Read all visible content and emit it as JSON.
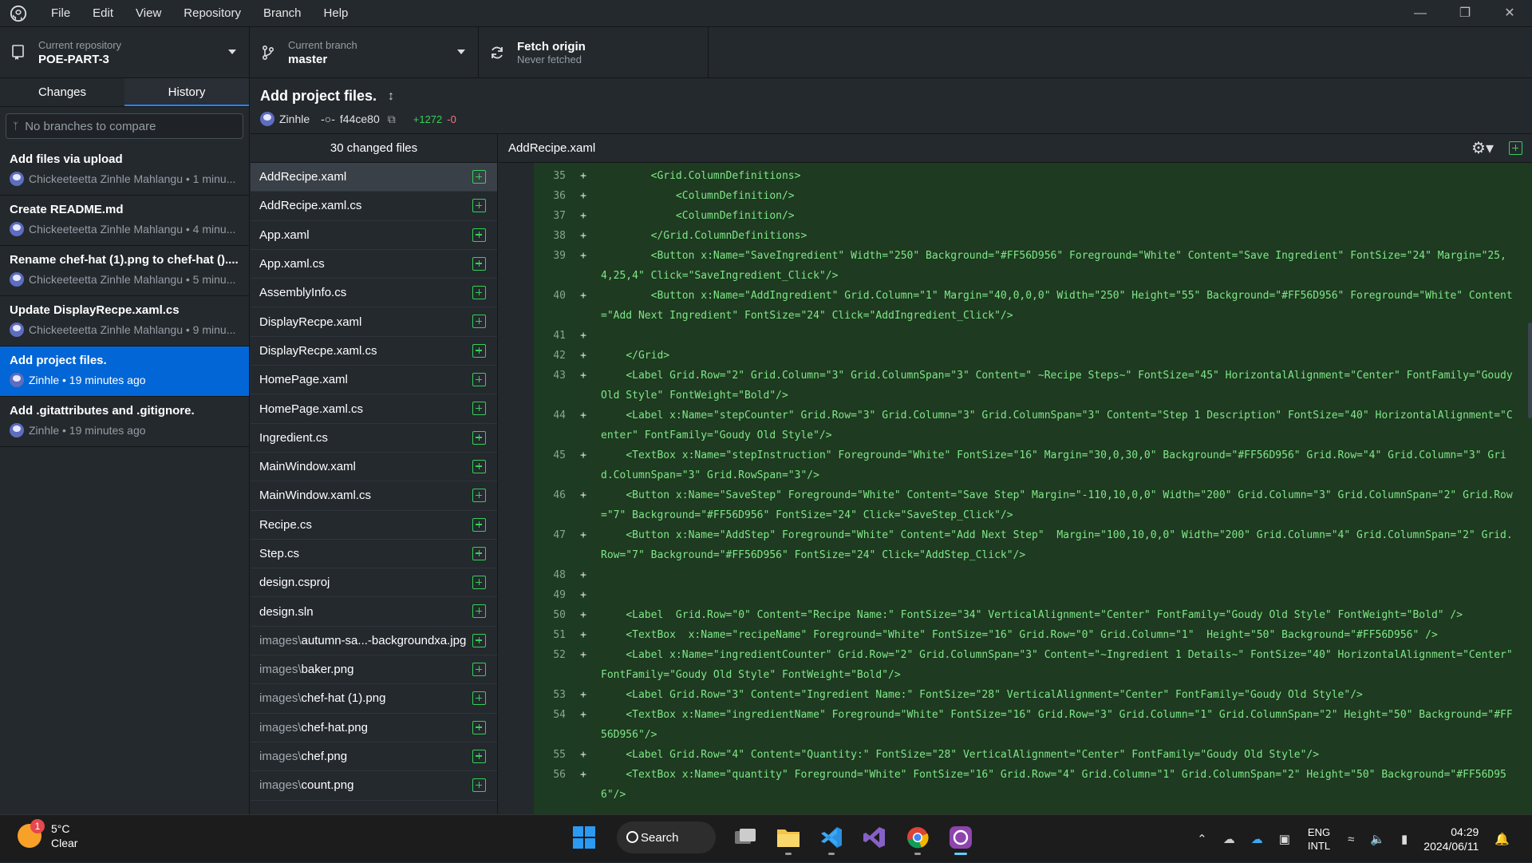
{
  "menu": [
    "File",
    "Edit",
    "View",
    "Repository",
    "Branch",
    "Help"
  ],
  "toolbar": {
    "repo_label": "Current repository",
    "repo_value": "POE-PART-3",
    "branch_label": "Current branch",
    "branch_value": "master",
    "fetch_label": "Fetch origin",
    "fetch_sub": "Never fetched"
  },
  "sidebar": {
    "tab_changes": "Changes",
    "tab_history": "History",
    "compare_placeholder": "No branches to compare",
    "commits": [
      {
        "title": "Add files via upload",
        "meta": "Chickeeteetta Zinhle Mahlangu • 1 minu..."
      },
      {
        "title": "Create README.md",
        "meta": "Chickeeteetta Zinhle Mahlangu • 4 minu..."
      },
      {
        "title": "Rename chef-hat (1).png to chef-hat ()....",
        "meta": "Chickeeteetta Zinhle Mahlangu • 5 minu..."
      },
      {
        "title": "Update DisplayRecpe.xaml.cs",
        "meta": "Chickeeteetta Zinhle Mahlangu • 9 minu..."
      },
      {
        "title": "Add project files.",
        "meta": "Zinhle • 19 minutes ago"
      },
      {
        "title": "Add .gitattributes and .gitignore.",
        "meta": "Zinhle • 19 minutes ago"
      }
    ]
  },
  "commit": {
    "title": "Add project files.",
    "author": "Zinhle",
    "sha": "f44ce80",
    "additions": "+1272",
    "deletions": "-0"
  },
  "files": {
    "header": "30 changed files",
    "items": [
      {
        "dir": "",
        "name": "AddRecipe.xaml"
      },
      {
        "dir": "",
        "name": "AddRecipe.xaml.cs"
      },
      {
        "dir": "",
        "name": "App.xaml"
      },
      {
        "dir": "",
        "name": "App.xaml.cs"
      },
      {
        "dir": "",
        "name": "AssemblyInfo.cs"
      },
      {
        "dir": "",
        "name": "DisplayRecpe.xaml"
      },
      {
        "dir": "",
        "name": "DisplayRecpe.xaml.cs"
      },
      {
        "dir": "",
        "name": "HomePage.xaml"
      },
      {
        "dir": "",
        "name": "HomePage.xaml.cs"
      },
      {
        "dir": "",
        "name": "Ingredient.cs"
      },
      {
        "dir": "",
        "name": "MainWindow.xaml"
      },
      {
        "dir": "",
        "name": "MainWindow.xaml.cs"
      },
      {
        "dir": "",
        "name": "Recipe.cs"
      },
      {
        "dir": "",
        "name": "Step.cs"
      },
      {
        "dir": "",
        "name": "design.csproj"
      },
      {
        "dir": "",
        "name": "design.sln"
      },
      {
        "dir": "images\\",
        "name": "autumn-sa...-backgroundxa.jpg"
      },
      {
        "dir": "images\\",
        "name": "baker.png"
      },
      {
        "dir": "images\\",
        "name": "chef-hat (1).png"
      },
      {
        "dir": "images\\",
        "name": "chef-hat.png"
      },
      {
        "dir": "images\\",
        "name": "chef.png"
      },
      {
        "dir": "images\\",
        "name": "count.png"
      }
    ]
  },
  "diff": {
    "filename": "AddRecipe.xaml",
    "lines": [
      {
        "n": "35",
        "code": "        <Grid.ColumnDefinitions>"
      },
      {
        "n": "36",
        "code": "            <ColumnDefinition/>"
      },
      {
        "n": "37",
        "code": "            <ColumnDefinition/>"
      },
      {
        "n": "38",
        "code": "        </Grid.ColumnDefinitions>"
      },
      {
        "n": "39",
        "code": "        <Button x:Name=\"SaveIngredient\" Width=\"250\" Background=\"#FF56D956\" Foreground=\"White\" Content=\"Save Ingredient\" FontSize=\"24\" Margin=\"25,4,25,4\" Click=\"SaveIngredient_Click\"/>"
      },
      {
        "n": "40",
        "code": "        <Button x:Name=\"AddIngredient\" Grid.Column=\"1\" Margin=\"40,0,0,0\" Width=\"250\" Height=\"55\" Background=\"#FF56D956\" Foreground=\"White\" Content=\"Add Next Ingredient\" FontSize=\"24\" Click=\"AddIngredient_Click\"/>"
      },
      {
        "n": "41",
        "code": ""
      },
      {
        "n": "42",
        "code": "    </Grid>"
      },
      {
        "n": "43",
        "code": "    <Label Grid.Row=\"2\" Grid.Column=\"3\" Grid.ColumnSpan=\"3\" Content=\" ~Recipe Steps~\" FontSize=\"45\" HorizontalAlignment=\"Center\" FontFamily=\"Goudy Old Style\" FontWeight=\"Bold\"/>"
      },
      {
        "n": "44",
        "code": "    <Label x:Name=\"stepCounter\" Grid.Row=\"3\" Grid.Column=\"3\" Grid.ColumnSpan=\"3\" Content=\"Step 1 Description\" FontSize=\"40\" HorizontalAlignment=\"Center\" FontFamily=\"Goudy Old Style\"/>"
      },
      {
        "n": "45",
        "code": "    <TextBox x:Name=\"stepInstruction\" Foreground=\"White\" FontSize=\"16\" Margin=\"30,0,30,0\" Background=\"#FF56D956\" Grid.Row=\"4\" Grid.Column=\"3\" Grid.ColumnSpan=\"3\" Grid.RowSpan=\"3\"/>"
      },
      {
        "n": "46",
        "code": "    <Button x:Name=\"SaveStep\" Foreground=\"White\" Content=\"Save Step\" Margin=\"-110,10,0,0\" Width=\"200\" Grid.Column=\"3\" Grid.ColumnSpan=\"2\" Grid.Row=\"7\" Background=\"#FF56D956\" FontSize=\"24\" Click=\"SaveStep_Click\"/>"
      },
      {
        "n": "47",
        "code": "    <Button x:Name=\"AddStep\" Foreground=\"White\" Content=\"Add Next Step\"  Margin=\"100,10,0,0\" Width=\"200\" Grid.Column=\"4\" Grid.ColumnSpan=\"2\" Grid.Row=\"7\" Background=\"#FF56D956\" FontSize=\"24\" Click=\"AddStep_Click\"/>"
      },
      {
        "n": "48",
        "code": ""
      },
      {
        "n": "49",
        "code": ""
      },
      {
        "n": "50",
        "code": "    <Label  Grid.Row=\"0\" Content=\"Recipe Name:\" FontSize=\"34\" VerticalAlignment=\"Center\" FontFamily=\"Goudy Old Style\" FontWeight=\"Bold\" />"
      },
      {
        "n": "51",
        "code": "    <TextBox  x:Name=\"recipeName\" Foreground=\"White\" FontSize=\"16\" Grid.Row=\"0\" Grid.Column=\"1\"  Height=\"50\" Background=\"#FF56D956\" />"
      },
      {
        "n": "52",
        "code": "    <Label x:Name=\"ingredientCounter\" Grid.Row=\"2\" Grid.ColumnSpan=\"3\" Content=\"~Ingredient 1 Details~\" FontSize=\"40\" HorizontalAlignment=\"Center\" FontFamily=\"Goudy Old Style\" FontWeight=\"Bold\"/>"
      },
      {
        "n": "53",
        "code": "    <Label Grid.Row=\"3\" Content=\"Ingredient Name:\" FontSize=\"28\" VerticalAlignment=\"Center\" FontFamily=\"Goudy Old Style\"/>"
      },
      {
        "n": "54",
        "code": "    <TextBox x:Name=\"ingredientName\" Foreground=\"White\" FontSize=\"16\" Grid.Row=\"3\" Grid.Column=\"1\" Grid.ColumnSpan=\"2\" Height=\"50\" Background=\"#FF56D956\"/>"
      },
      {
        "n": "55",
        "code": "    <Label Grid.Row=\"4\" Content=\"Quantity:\" FontSize=\"28\" VerticalAlignment=\"Center\" FontFamily=\"Goudy Old Style\"/>"
      },
      {
        "n": "56",
        "code": "    <TextBox x:Name=\"quantity\" Foreground=\"White\" FontSize=\"16\" Grid.Row=\"4\" Grid.Column=\"1\" Grid.ColumnSpan=\"2\" Height=\"50\" Background=\"#FF56D956\"/>"
      }
    ]
  },
  "taskbar": {
    "temp": "5°C",
    "condition": "Clear",
    "badge": "1",
    "search": "Search",
    "lang1": "ENG",
    "lang2": "INTL",
    "time": "04:29",
    "date": "2024/06/11"
  }
}
